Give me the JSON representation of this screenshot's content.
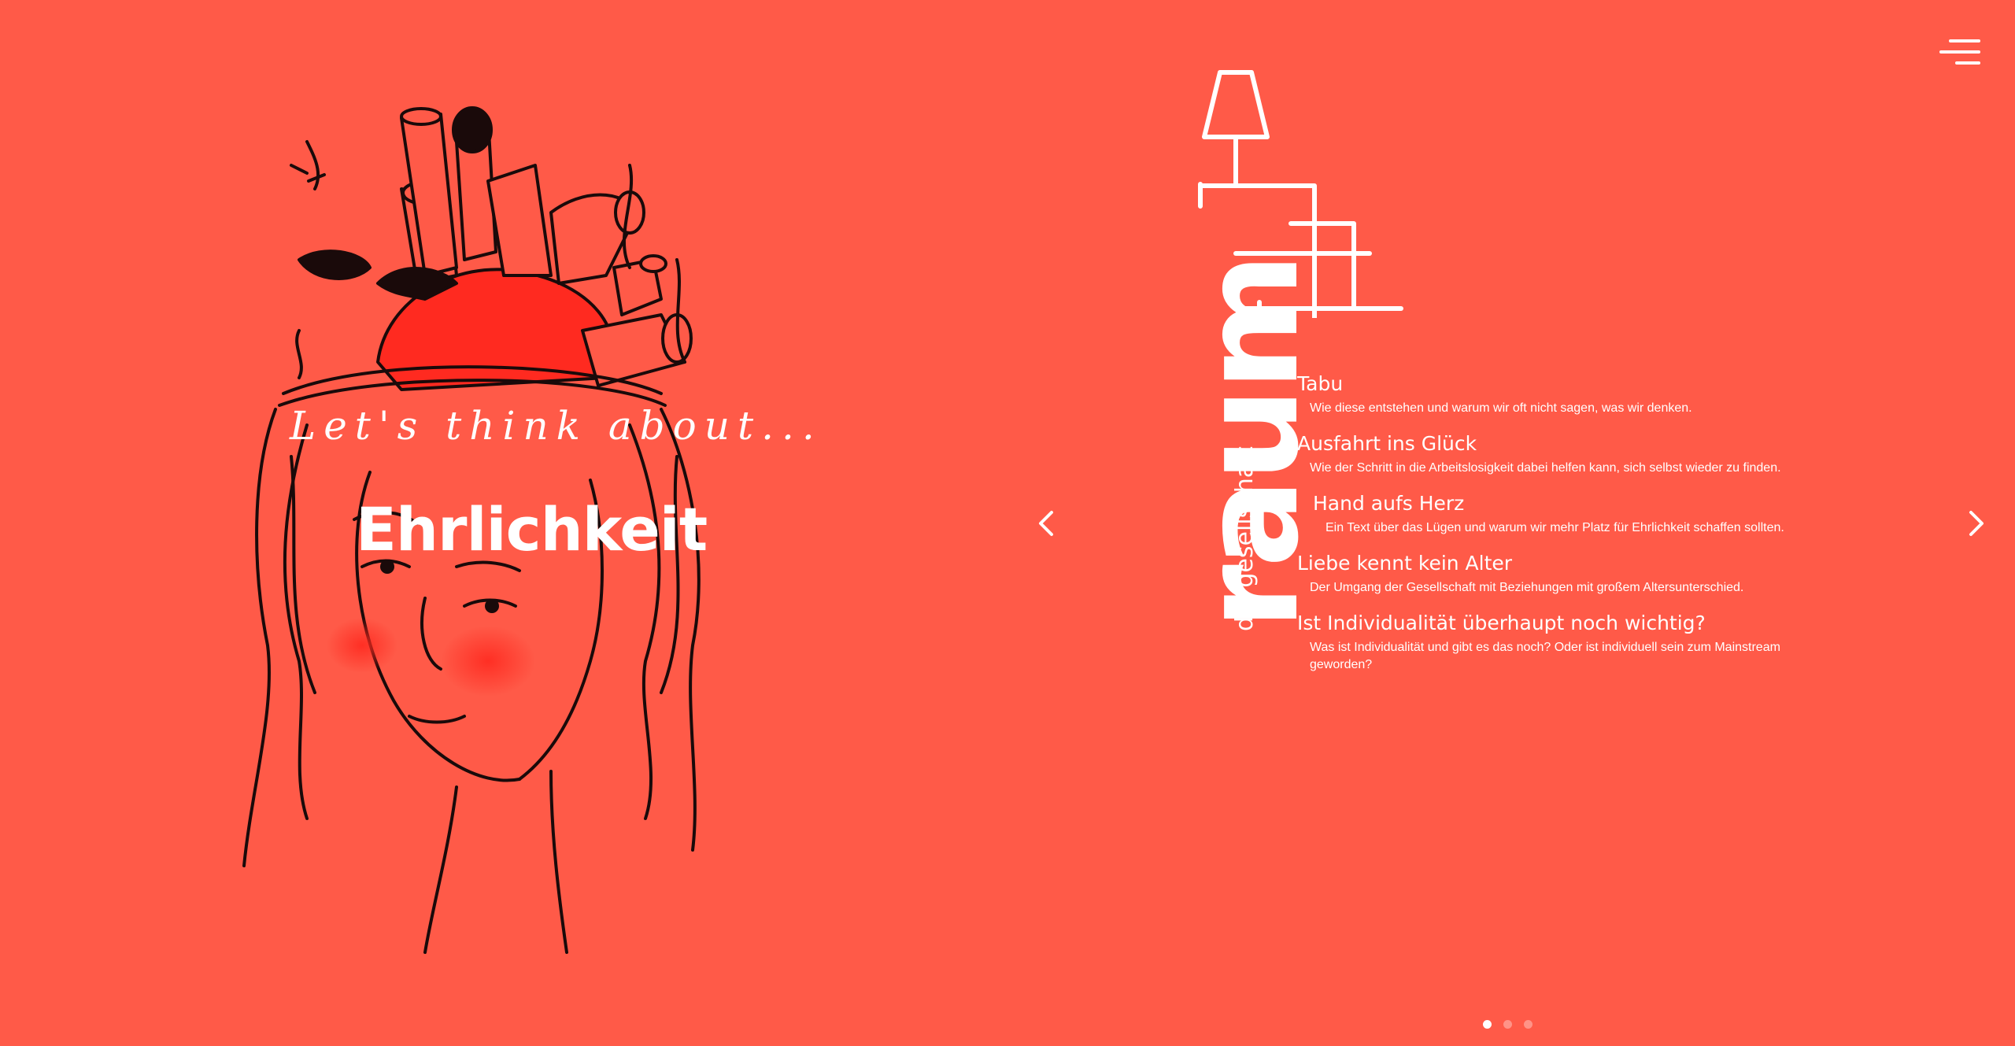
{
  "colors": {
    "background": "#ff5a48",
    "accent": "#ff2a20",
    "ink": "#1a0a0a",
    "text": "#ffffff"
  },
  "header": {
    "menu_icon": "hamburger-menu-icon"
  },
  "hero": {
    "kicker": "Let's think about...",
    "title": "Ehrlichkeit"
  },
  "section": {
    "word": "raum",
    "subtitle": "die gesellschaft"
  },
  "topics": [
    {
      "title": "Tabu",
      "description": "Wie diese entstehen und warum wir oft nicht sagen, was wir denken."
    },
    {
      "title": "Ausfahrt ins Glück",
      "description": "Wie der Schritt in die Arbeitslosigkeit dabei helfen kann, sich selbst wieder zu finden."
    },
    {
      "title": "Hand aufs Herz",
      "description": "Ein Text über das Lügen und warum wir mehr Platz für Ehrlichkeit schaffen sollten."
    },
    {
      "title": "Liebe kennt kein Alter",
      "description": "Der Umgang der Gesellschaft mit Beziehungen mit großem Altersunterschied."
    },
    {
      "title": "Ist Individualität überhaupt noch wichtig?",
      "description": "Was ist Individualität und gibt es das noch? Oder ist individuell sein zum Mainstream geworden?"
    }
  ],
  "carousel": {
    "prev_icon": "chevron-left-icon",
    "next_icon": "chevron-right-icon",
    "slides": 3,
    "active": 1
  }
}
